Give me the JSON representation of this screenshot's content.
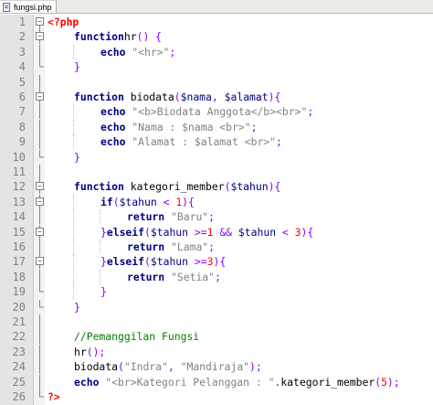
{
  "tab": {
    "filename": "fungsi.php"
  },
  "lines": [
    {
      "n": "1",
      "fold": "open-top",
      "indent": 0,
      "tokens": [
        [
          "php",
          "<?php"
        ]
      ]
    },
    {
      "n": "2",
      "fold": "open",
      "indent": 1,
      "tokens": [
        [
          "kw",
          "function"
        ],
        [
          "",
          "hr"
        ],
        [
          "op",
          "()"
        ],
        [
          "",
          " "
        ],
        [
          "op",
          "{"
        ]
      ]
    },
    {
      "n": "3",
      "fold": "line",
      "indent": 2,
      "tokens": [
        [
          "kw",
          "echo"
        ],
        [
          "",
          " "
        ],
        [
          "str",
          "\"<hr>\""
        ],
        [
          "op",
          ";"
        ]
      ]
    },
    {
      "n": "4",
      "fold": "end",
      "indent": 1,
      "tokens": [
        [
          "op",
          "}"
        ]
      ]
    },
    {
      "n": "5",
      "fold": "line",
      "indent": 0,
      "tokens": []
    },
    {
      "n": "6",
      "fold": "open",
      "indent": 1,
      "tokens": [
        [
          "kw",
          "function"
        ],
        [
          "",
          " biodata"
        ],
        [
          "op",
          "("
        ],
        [
          "var",
          "$nama"
        ],
        [
          "op",
          ","
        ],
        [
          "",
          " "
        ],
        [
          "var",
          "$alamat"
        ],
        [
          "op",
          "){"
        ]
      ]
    },
    {
      "n": "7",
      "fold": "line",
      "indent": 2,
      "tokens": [
        [
          "kw",
          "echo"
        ],
        [
          "",
          " "
        ],
        [
          "str",
          "\"<b>Biodata Anggota</b><br>\""
        ],
        [
          "op",
          ";"
        ]
      ]
    },
    {
      "n": "8",
      "fold": "line",
      "indent": 2,
      "tokens": [
        [
          "kw",
          "echo"
        ],
        [
          "",
          " "
        ],
        [
          "str",
          "\"Nama : $nama <br>\""
        ],
        [
          "op",
          ";"
        ]
      ]
    },
    {
      "n": "9",
      "fold": "line",
      "indent": 2,
      "tokens": [
        [
          "kw",
          "echo"
        ],
        [
          "",
          " "
        ],
        [
          "str",
          "\"Alamat : $alamat <br>\""
        ],
        [
          "op",
          ";"
        ]
      ]
    },
    {
      "n": "10",
      "fold": "end",
      "indent": 1,
      "tokens": [
        [
          "op",
          "}"
        ]
      ]
    },
    {
      "n": "11",
      "fold": "line",
      "indent": 0,
      "tokens": []
    },
    {
      "n": "12",
      "fold": "open",
      "indent": 1,
      "tokens": [
        [
          "kw",
          "function"
        ],
        [
          "",
          " kategori_member"
        ],
        [
          "op",
          "("
        ],
        [
          "var",
          "$tahun"
        ],
        [
          "op",
          "){"
        ]
      ]
    },
    {
      "n": "13",
      "fold": "open",
      "indent": 2,
      "tokens": [
        [
          "kw",
          "if"
        ],
        [
          "op",
          "("
        ],
        [
          "var",
          "$tahun"
        ],
        [
          "",
          " "
        ],
        [
          "op",
          "<"
        ],
        [
          "",
          " "
        ],
        [
          "num",
          "1"
        ],
        [
          "op",
          "){"
        ]
      ]
    },
    {
      "n": "14",
      "fold": "line",
      "indent": 3,
      "tokens": [
        [
          "kw",
          "return"
        ],
        [
          "",
          " "
        ],
        [
          "str",
          "\"Baru\""
        ],
        [
          "op",
          ";"
        ]
      ]
    },
    {
      "n": "15",
      "fold": "mid",
      "indent": 2,
      "tokens": [
        [
          "op",
          "}"
        ],
        [
          "kw",
          "elseif"
        ],
        [
          "op",
          "("
        ],
        [
          "var",
          "$tahun"
        ],
        [
          "",
          " "
        ],
        [
          "op",
          ">="
        ],
        [
          "num",
          "1"
        ],
        [
          "",
          " "
        ],
        [
          "op",
          "&&"
        ],
        [
          "",
          " "
        ],
        [
          "var",
          "$tahun"
        ],
        [
          "",
          " "
        ],
        [
          "op",
          "<"
        ],
        [
          "",
          " "
        ],
        [
          "num",
          "3"
        ],
        [
          "op",
          "){"
        ]
      ]
    },
    {
      "n": "16",
      "fold": "line",
      "indent": 3,
      "tokens": [
        [
          "kw",
          "return"
        ],
        [
          "",
          " "
        ],
        [
          "str",
          "\"Lama\""
        ],
        [
          "op",
          ";"
        ]
      ]
    },
    {
      "n": "17",
      "fold": "mid",
      "indent": 2,
      "tokens": [
        [
          "op",
          "}"
        ],
        [
          "kw",
          "elseif"
        ],
        [
          "op",
          "("
        ],
        [
          "var",
          "$tahun"
        ],
        [
          "",
          " "
        ],
        [
          "op",
          ">="
        ],
        [
          "num",
          "3"
        ],
        [
          "op",
          "){"
        ]
      ]
    },
    {
      "n": "18",
      "fold": "line",
      "indent": 3,
      "tokens": [
        [
          "kw",
          "return"
        ],
        [
          "",
          " "
        ],
        [
          "str",
          "\"Setia\""
        ],
        [
          "op",
          ";"
        ]
      ]
    },
    {
      "n": "19",
      "fold": "end",
      "indent": 2,
      "tokens": [
        [
          "op",
          "}"
        ]
      ]
    },
    {
      "n": "20",
      "fold": "end",
      "indent": 1,
      "tokens": [
        [
          "op",
          "}"
        ]
      ]
    },
    {
      "n": "21",
      "fold": "line",
      "indent": 0,
      "tokens": []
    },
    {
      "n": "22",
      "fold": "line",
      "indent": 1,
      "tokens": [
        [
          "cm",
          "//Pemanggilan Fungsi"
        ]
      ]
    },
    {
      "n": "23",
      "fold": "line",
      "indent": 1,
      "tokens": [
        [
          "",
          "hr"
        ],
        [
          "op",
          "();"
        ]
      ]
    },
    {
      "n": "24",
      "fold": "line",
      "indent": 1,
      "tokens": [
        [
          "",
          "biodata"
        ],
        [
          "op",
          "("
        ],
        [
          "str",
          "\"Indra\""
        ],
        [
          "op",
          ","
        ],
        [
          "",
          " "
        ],
        [
          "str",
          "\"Mandiraja\""
        ],
        [
          "op",
          ");"
        ]
      ]
    },
    {
      "n": "25",
      "fold": "line",
      "indent": 1,
      "tokens": [
        [
          "kw",
          "echo"
        ],
        [
          "",
          " "
        ],
        [
          "str",
          "\"<br>Kategori Pelanggan : \""
        ],
        [
          "op",
          "."
        ],
        [
          "",
          "kategori_member"
        ],
        [
          "op",
          "("
        ],
        [
          "num",
          "5"
        ],
        [
          "op",
          ");"
        ]
      ]
    },
    {
      "n": "26",
      "fold": "end",
      "indent": 0,
      "tokens": [
        [
          "php",
          "?>"
        ]
      ]
    }
  ]
}
